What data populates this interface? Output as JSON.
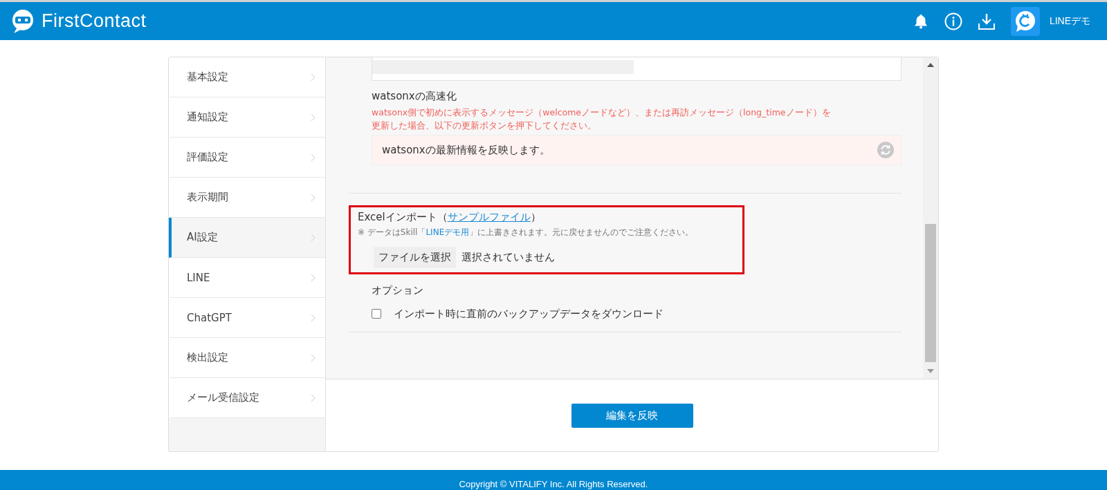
{
  "header": {
    "logo": "FirstContact",
    "account": "LINEデモ"
  },
  "sidebar": {
    "items": [
      {
        "label": "基本設定",
        "selected": false
      },
      {
        "label": "通知設定",
        "selected": false
      },
      {
        "label": "評価設定",
        "selected": false
      },
      {
        "label": "表示期間",
        "selected": false
      },
      {
        "label": "AI設定",
        "selected": true
      },
      {
        "label": "LINE",
        "selected": false
      },
      {
        "label": "ChatGPT",
        "selected": false
      },
      {
        "label": "検出設定",
        "selected": false
      },
      {
        "label": "メール受信設定",
        "selected": false
      }
    ]
  },
  "speedup": {
    "title": "watsonxの高速化",
    "note": "watsonx側で初めに表示するメッセージ（welcomeノードなど）、または再訪メッセージ（long_timeノード）を更新した場合、以下の更新ボタンを押下してください。",
    "refresh_field": "watsonxの最新情報を反映します。"
  },
  "excel_import": {
    "label": "Excelインポート（",
    "link": "サンプルファイル",
    "label_end": "）",
    "note_before": "※ データはSkill「",
    "note_link": "LINEデモ用",
    "note_after": "」に上書きされます。元に戻せませんのでご注意ください。",
    "file_button": "ファイルを選択",
    "file_status": "選択されていません"
  },
  "options": {
    "title": "オプション",
    "items": [
      {
        "label": "インポート時に直前のバックアップデータをダウンロード",
        "checked": false
      }
    ]
  },
  "submit": "編集を反映",
  "footer": "Copyright © VITALIFY Inc. All Rights Reserved."
}
